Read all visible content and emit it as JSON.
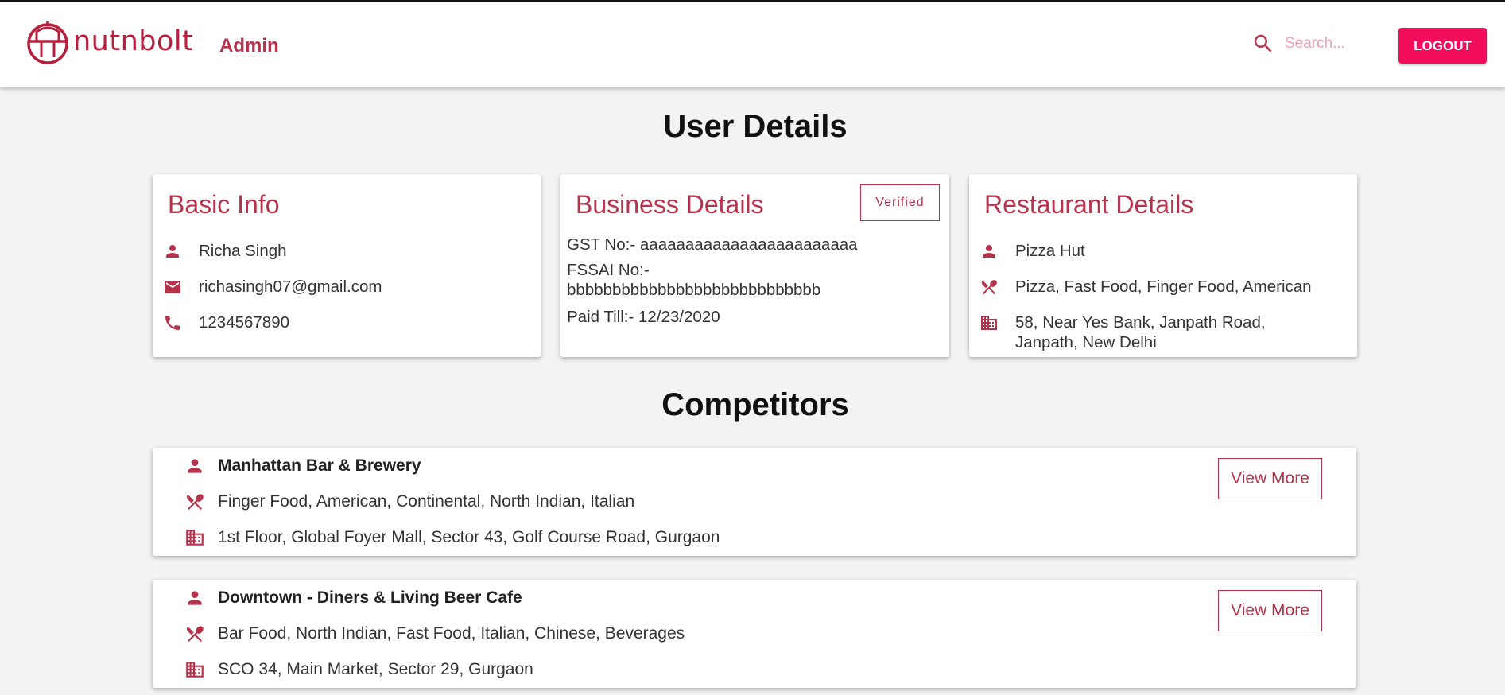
{
  "header": {
    "brand": "nutnbolt",
    "admin_label": "Admin",
    "search_placeholder": "Search...",
    "logout_label": "LOGOUT"
  },
  "user_details": {
    "title": "User Details",
    "basic_info": {
      "title": "Basic Info",
      "name": "Richa Singh",
      "email": "richasingh07@gmail.com",
      "phone": "1234567890"
    },
    "business_details": {
      "title": "Business Details",
      "status": "Verified",
      "gst": "GST No:- aaaaaaaaaaaaaaaaaaaaaaaa",
      "fssai_label": "FSSAI No:-",
      "fssai_value": "bbbbbbbbbbbbbbbbbbbbbbbbbbbb",
      "paid_till": "Paid Till:- 12/23/2020"
    },
    "restaurant_details": {
      "title": "Restaurant Details",
      "name": "Pizza Hut",
      "cuisines": "Pizza, Fast Food, Finger Food, American",
      "address_line1": "58, Near Yes Bank, Janpath Road,",
      "address_line2": "Janpath, New Delhi"
    }
  },
  "competitors": {
    "title": "Competitors",
    "view_more_label": "View More",
    "items": [
      {
        "name": "Manhattan Bar & Brewery",
        "cuisines": "Finger Food, American, Continental, North Indian, Italian",
        "address": "1st Floor, Global Foyer Mall, Sector 43, Golf Course Road, Gurgaon"
      },
      {
        "name": "Downtown - Diners & Living Beer Cafe",
        "cuisines": "Bar Food, North Indian, Fast Food, Italian, Chinese, Beverages",
        "address": "SCO 34, Main Market, Sector 29, Gurgaon"
      }
    ]
  },
  "colors": {
    "accent": "#b7334c",
    "logout_bg": "#f20c5c",
    "background": "#f3f3f3"
  },
  "icons": [
    "brand-logo-icon",
    "search-icon",
    "person-icon",
    "email-icon",
    "phone-icon",
    "cutlery-icon",
    "building-icon"
  ]
}
